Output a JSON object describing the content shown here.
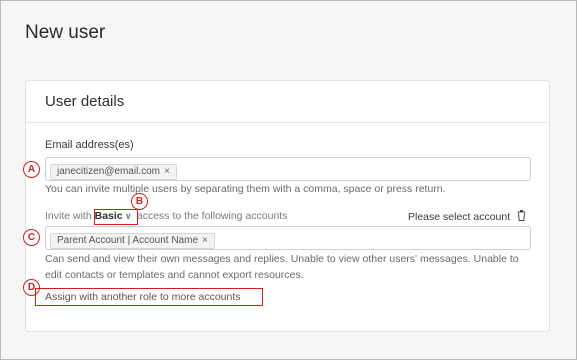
{
  "page": {
    "title": "New user"
  },
  "card": {
    "title": "User details"
  },
  "email": {
    "label": "Email address(es)",
    "chips": [
      {
        "text": "janecitizen@email.com",
        "remove": "×"
      }
    ],
    "helper": "You can invite multiple users by separating them with a comma, space or press return."
  },
  "invite": {
    "prefix": "Invite with",
    "role": "Basic",
    "chevron": "∨",
    "suffix": "access to the following accounts",
    "select_account": "Please select account"
  },
  "accounts": {
    "chips": [
      {
        "text": "Parent Account | Account Name",
        "remove": "×"
      }
    ],
    "helper_line1": "Can send and view their own messages and replies. Unable to view other users' messages. Unable to",
    "helper_line2": "edit contacts or templates and cannot export resources."
  },
  "assign": {
    "label": "Assign with another role to more accounts"
  },
  "markers": {
    "a": "A",
    "b": "B",
    "c": "C",
    "d": "D"
  },
  "colors": {
    "annotation": "#d11f1f",
    "background": "#f6f6f6",
    "card": "#ffffff"
  },
  "icons": {
    "trash": "trash-icon",
    "chevron": "chevron-down-icon"
  }
}
